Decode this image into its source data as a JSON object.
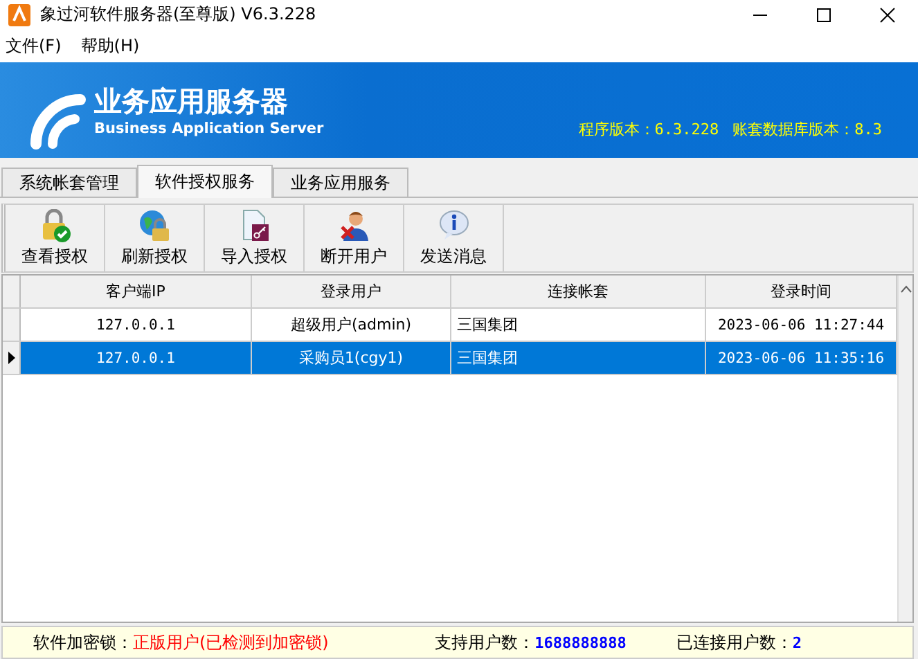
{
  "window": {
    "title": "象过河软件服务器(至尊版) V6.3.228"
  },
  "menu": [
    "文件(F)",
    "帮助(H)"
  ],
  "banner": {
    "title": "业务应用服务器",
    "subtitle": "Business Application Server",
    "program_version": "程序版本：6.3.228",
    "db_version": "账套数据库版本：8.3"
  },
  "tabs": [
    {
      "label": "系统帐套管理",
      "selected": false
    },
    {
      "label": "软件授权服务",
      "selected": true
    },
    {
      "label": "业务应用服务",
      "selected": false
    }
  ],
  "toolbar": [
    {
      "label": "查看授权",
      "kind": "view"
    },
    {
      "label": "刷新授权",
      "kind": "refresh"
    },
    {
      "label": "导入授权",
      "kind": "import"
    },
    {
      "label": "断开用户",
      "kind": "disconnect"
    },
    {
      "label": "发送消息",
      "kind": "message"
    }
  ],
  "table": {
    "columns": [
      "客户端IP",
      "登录用户",
      "连接帐套",
      "登录时间"
    ],
    "rows": [
      {
        "cells": [
          "127.0.0.1",
          "超级用户(admin)",
          "三国集团",
          "2023-06-06 11:27:44"
        ],
        "selected": false
      },
      {
        "cells": [
          "127.0.0.1",
          "采购员1(cgy1)",
          "三国集团",
          "2023-06-06 11:35:16"
        ],
        "selected": true
      }
    ]
  },
  "status_bar": {
    "lock_label": "软件加密锁：",
    "lock_value": "正版用户(已检测到加密锁)",
    "support_label": "支持用户数：",
    "support_value": "1688888888",
    "connected_label": "已连接用户数：",
    "connected_value": "2"
  }
}
